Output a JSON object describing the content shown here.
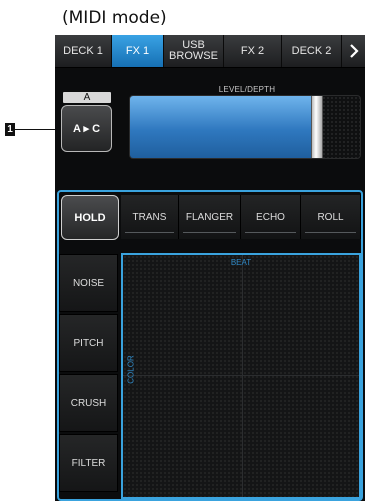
{
  "caption": "(MIDI mode)",
  "tabs": [
    {
      "label": "DECK 1"
    },
    {
      "label": "FX 1",
      "active": true
    },
    {
      "label": "USB\nBROWSE"
    },
    {
      "label": "FX 2"
    },
    {
      "label": "DECK 2"
    }
  ],
  "next_icon": "chevron-right-icon",
  "assign": {
    "header": "A",
    "button": "A ▸ C"
  },
  "level": {
    "label": "LEVEL/DEPTH",
    "value_fraction": 0.81
  },
  "fx": {
    "hold": "HOLD",
    "tabs": [
      "TRANS",
      "FLANGER",
      "ECHO",
      "ROLL"
    ],
    "side": [
      "NOISE",
      "PITCH",
      "CRUSH",
      "FILTER"
    ],
    "beat_label": "BEAT",
    "color_label": "COLOR"
  },
  "callout": {
    "number": "1"
  },
  "colors": {
    "accent": "#3aa3de",
    "active_tab": "#1f86d0"
  }
}
